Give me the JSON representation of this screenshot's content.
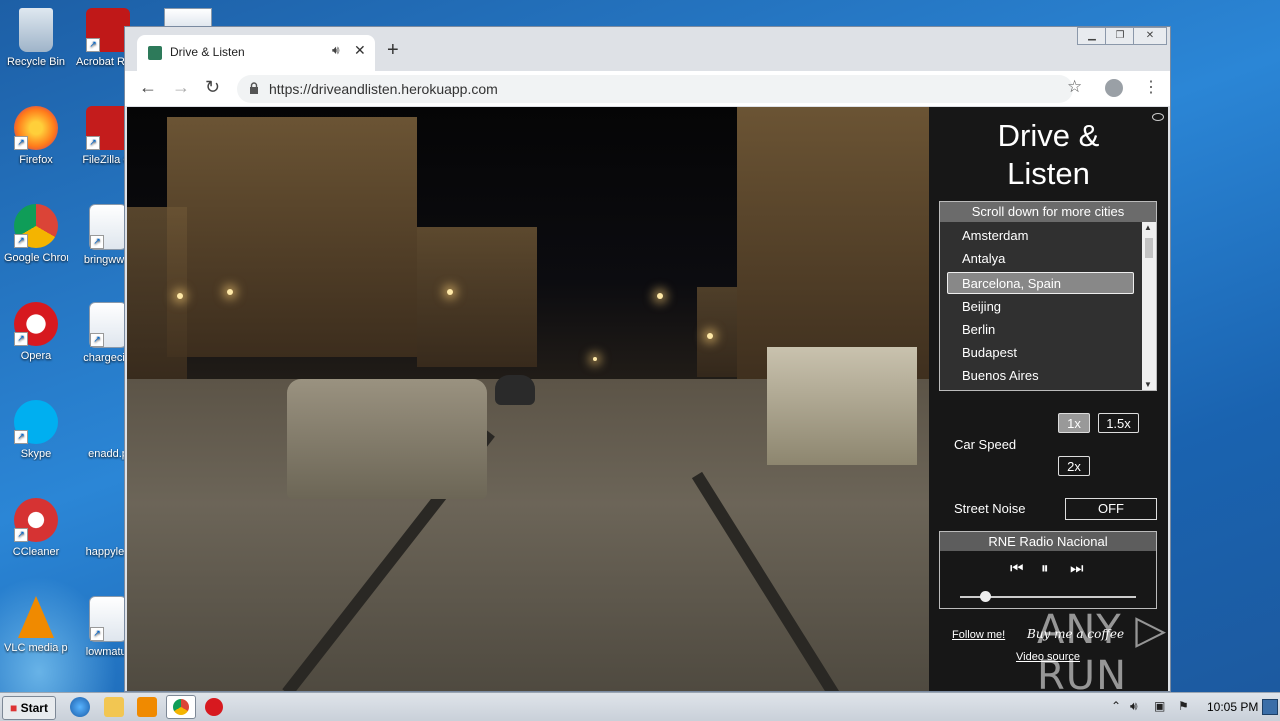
{
  "desktop": {
    "icons": [
      {
        "label": "Recycle Bin",
        "color": "#9fb4c9"
      },
      {
        "label": "Acrobat Reader",
        "color": "#c01818"
      },
      {
        "label": "Firefox",
        "color": "#ff7a1a"
      },
      {
        "label": "FileZilla Cl",
        "color": "#c41c1c"
      },
      {
        "label": "Google Chrome",
        "color": "#4285f4"
      },
      {
        "label": "bringwww",
        "color": "#2b579a"
      },
      {
        "label": "Opera",
        "color": "#d7191f"
      },
      {
        "label": "chargecivi",
        "color": "#2b579a"
      },
      {
        "label": "Skype",
        "color": "#00aff0"
      },
      {
        "label": "enadd.p",
        "color": "#cfd8e0"
      },
      {
        "label": "CCleaner",
        "color": "#d63333"
      },
      {
        "label": "happylea",
        "color": "#cfd8e0"
      },
      {
        "label": "VLC media player",
        "color": "#f08a00"
      },
      {
        "label": "lowmatur",
        "color": "#2b579a"
      }
    ]
  },
  "browser": {
    "tab_title": "Drive & Listen",
    "new_tab": "+",
    "url": "https://driveandlisten.herokuapp.com"
  },
  "app": {
    "title_line1": "Drive &",
    "title_line2": "Listen",
    "city_header": "Scroll down for more cities",
    "cities": [
      "Amsterdam",
      "Antalya",
      "Barcelona, Spain",
      "Beijing",
      "Berlin",
      "Budapest",
      "Buenos Aires"
    ],
    "selected_city": "Barcelona, Spain",
    "car_speed_label": "Car Speed",
    "speed_1x": "1x",
    "speed_15x": "1.5x",
    "speed_2x": "2x",
    "street_noise_label": "Street Noise",
    "street_noise_value": "OFF",
    "radio_station": "RNE Radio Nacional",
    "volume_fraction": 0.14,
    "follow_link": "Follow me!",
    "coffee_link": "Buy me a coffee",
    "video_source_link": "Video source",
    "watermark": "ANY ▷ RUN"
  },
  "taskbar": {
    "start": "Start",
    "clock": "10:05 PM"
  }
}
